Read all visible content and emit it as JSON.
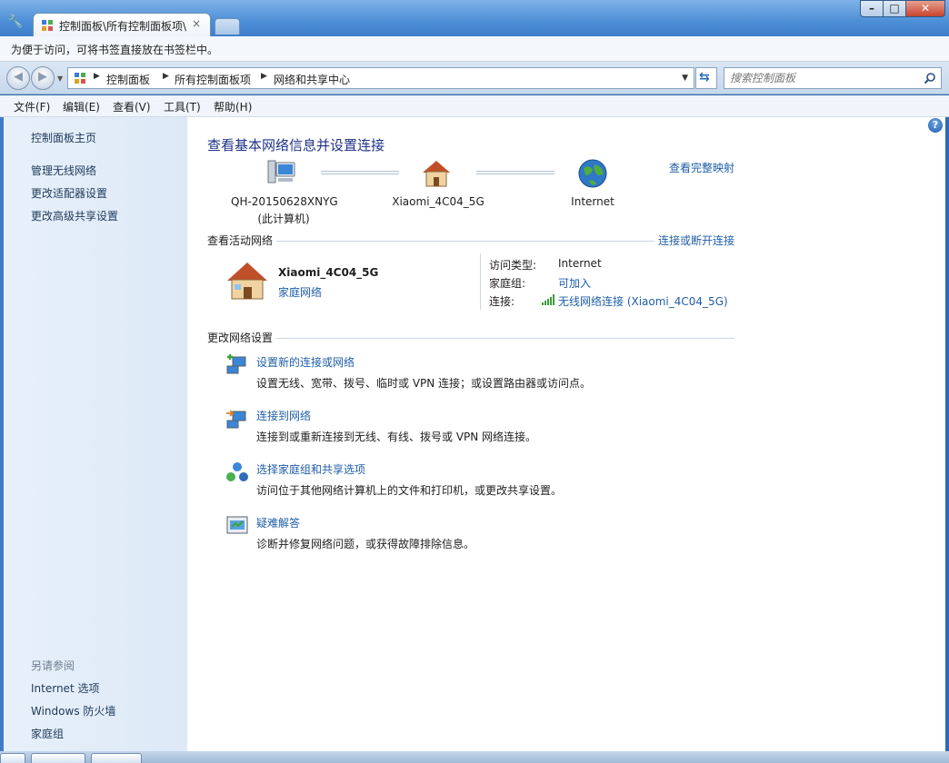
{
  "window": {
    "tab_title": "控制面板\\所有控制面板项\\",
    "tab_close": "×",
    "controls": {
      "minimize": "–",
      "maximize": "□",
      "close": "✕"
    }
  },
  "bookmark_notice": "为便于访问，可将书签直接放在书签栏中。",
  "address": {
    "crumbs": [
      "控制面板",
      "所有控制面板项",
      "网络和共享中心"
    ],
    "search_placeholder": "搜索控制面板"
  },
  "menu": [
    "文件(F)",
    "编辑(E)",
    "查看(V)",
    "工具(T)",
    "帮助(H)"
  ],
  "left": {
    "home": "控制面板主页",
    "links": [
      "管理无线网络",
      "更改适配器设置",
      "更改高级共享设置"
    ],
    "see_also_title": "另请参阅",
    "see_also": [
      "Internet 选项",
      "Windows 防火墙",
      "家庭组"
    ]
  },
  "main": {
    "title": "查看基本网络信息并设置连接",
    "full_map": "查看完整映射",
    "map": {
      "computer_name": "QH-20150628XNYG",
      "computer_sub": "(此计算机)",
      "router": "Xiaomi_4C04_5G",
      "internet": "Internet"
    },
    "active_section": "查看活动网络",
    "connect_toggle": "连接或断开连接",
    "active_network": {
      "name": "Xiaomi_4C04_5G",
      "type_link": "家庭网络",
      "access_type_label": "访问类型:",
      "access_type_value": "Internet",
      "homegroup_label": "家庭组:",
      "homegroup_value": "可加入",
      "connection_label": "连接:",
      "connection_value": "无线网络连接 (Xiaomi_4C04_5G)"
    },
    "change_section": "更改网络设置",
    "tasks": [
      {
        "title": "设置新的连接或网络",
        "desc": "设置无线、宽带、拨号、临时或 VPN 连接；或设置路由器或访问点。",
        "icon": "new-connection-icon"
      },
      {
        "title": "连接到网络",
        "desc": "连接到或重新连接到无线、有线、拨号或 VPN 网络连接。",
        "icon": "connect-network-icon"
      },
      {
        "title": "选择家庭组和共享选项",
        "desc": "访问位于其他网络计算机上的文件和打印机，或更改共享设置。",
        "icon": "homegroup-icon"
      },
      {
        "title": "疑难解答",
        "desc": "诊断并修复网络问题，或获得故障排除信息。",
        "icon": "troubleshoot-icon"
      }
    ]
  },
  "colors": {
    "link": "#1f5ea8",
    "title": "#1e3287",
    "left_pane": "#e3edf8"
  }
}
